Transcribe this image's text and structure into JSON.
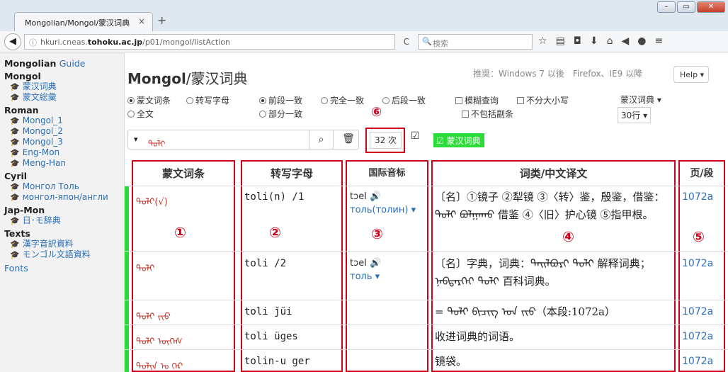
{
  "browser": {
    "tab_title": "Mongolian/Mongol/蒙汉词典",
    "tab_close": "×",
    "new_tab": "+",
    "url_prefix": "hkuri.cneas.",
    "url_domain": "tohoku.ac.jp",
    "url_path": "/p01/mongol/listAction",
    "search_placeholder": "検索"
  },
  "sidebar": {
    "groups": [
      {
        "title": "Mongolian",
        "extra": "Guide"
      },
      {
        "title": "Mongol",
        "links": [
          "蒙汉词典",
          "蒙文総彙"
        ]
      },
      {
        "title": "Roman",
        "links": [
          "Mongol_1",
          "Mongol_2",
          "Mongol_3",
          "Eng-Mon",
          "Meng-Han"
        ]
      },
      {
        "title": "Cyril",
        "links": [
          "Монгол Толь",
          "монгол-япон/англи"
        ]
      },
      {
        "title": "Jap-Mon",
        "links": [
          "日･モ辞典"
        ]
      },
      {
        "title": "Texts",
        "links": [
          "漢字音訳資料",
          "モンゴル文語資料"
        ]
      }
    ],
    "fonts": "Fonts"
  },
  "header": {
    "title_latin": "Mongol",
    "title_cn": "/蒙汉词典",
    "recommend": "推奨：Windows 7 以後　Firefox、IE9 以降",
    "help": "Help"
  },
  "options": {
    "r1a": "蒙文词条",
    "r1b": "转写字母",
    "r1c": "全文",
    "r2a": "前段一致",
    "r2b": "完全一致",
    "r2c": "后段一致",
    "r2d": "部分一致",
    "c1": "模糊查询",
    "c2": "不分大小写",
    "c3": "不包括副条",
    "dict_select": "蒙汉词典",
    "rows_select": "30行"
  },
  "search": {
    "term": "ᠲᠣᠯᠢ",
    "count": "32 次",
    "dict_badge": "蒙汉词典"
  },
  "markers": [
    "①",
    "②",
    "③",
    "④",
    "⑤",
    "⑥"
  ],
  "table": {
    "headers": [
      "蒙文词条",
      "转写字母",
      "国际音标",
      "词类/中文译文",
      "页/段"
    ],
    "rows": [
      {
        "mong": "ᠲᠣᠯᠢ(√)",
        "translit": "toli(n) /1",
        "ipa": "tɔel",
        "cyr": "толь(толин)",
        "trans": "〔名〕①镜子 ②犁镜 ③〈转〉鉴，殷鉴，借鉴：ᠲᠣᠯᠢ ᠪᠣᠯᠭᠠᠬᠤ 借鉴 ④〈旧〉护心镜 ⑤指甲根。",
        "page": "1072a"
      },
      {
        "mong": "ᠲᠣᠯᠢ",
        "translit": "toli /2",
        "ipa": "tɔel",
        "cyr": "толь",
        "trans": "〔名〕字典，词典：ᠲᠠᠢᠯᠪᠤᠷᠢ ᠲᠣᠯᠢ 解释词典； ᠨᠡᠪᠲᠡᠷᠬᠡᠢ ᠲᠣᠯᠢ 百科词典。",
        "page": "1072a"
      },
      {
        "mong": "ᠲᠣᠯᠢ ᠵᠢᠤ",
        "translit": "toli ǰüi",
        "ipa": "",
        "cyr": "",
        "trans": "= ᠲᠣᠯᠢ ᠪᠢᠴᠢᠭ ᠤᠨ ᠵᠢᠤ（本段:1072a）",
        "page": "1072a"
      },
      {
        "mong": "ᠲᠣᠯᠢ ᠦᠭᠡᠰ",
        "translit": "toli üges",
        "ipa": "",
        "cyr": "",
        "trans": "收进词典的词语。",
        "page": "1072a"
      },
      {
        "mong": "ᠲᠣᠯᠢᠨ ᠤ ᠭᠡᠷ",
        "translit": "tolin-u ger",
        "ipa": "",
        "cyr": "",
        "trans": "镜袋。",
        "page": "1072a"
      }
    ]
  },
  "colors": {
    "accent_red": "#d0021b",
    "badge_green": "#2ddc39",
    "link_blue": "#2a6fb8"
  }
}
